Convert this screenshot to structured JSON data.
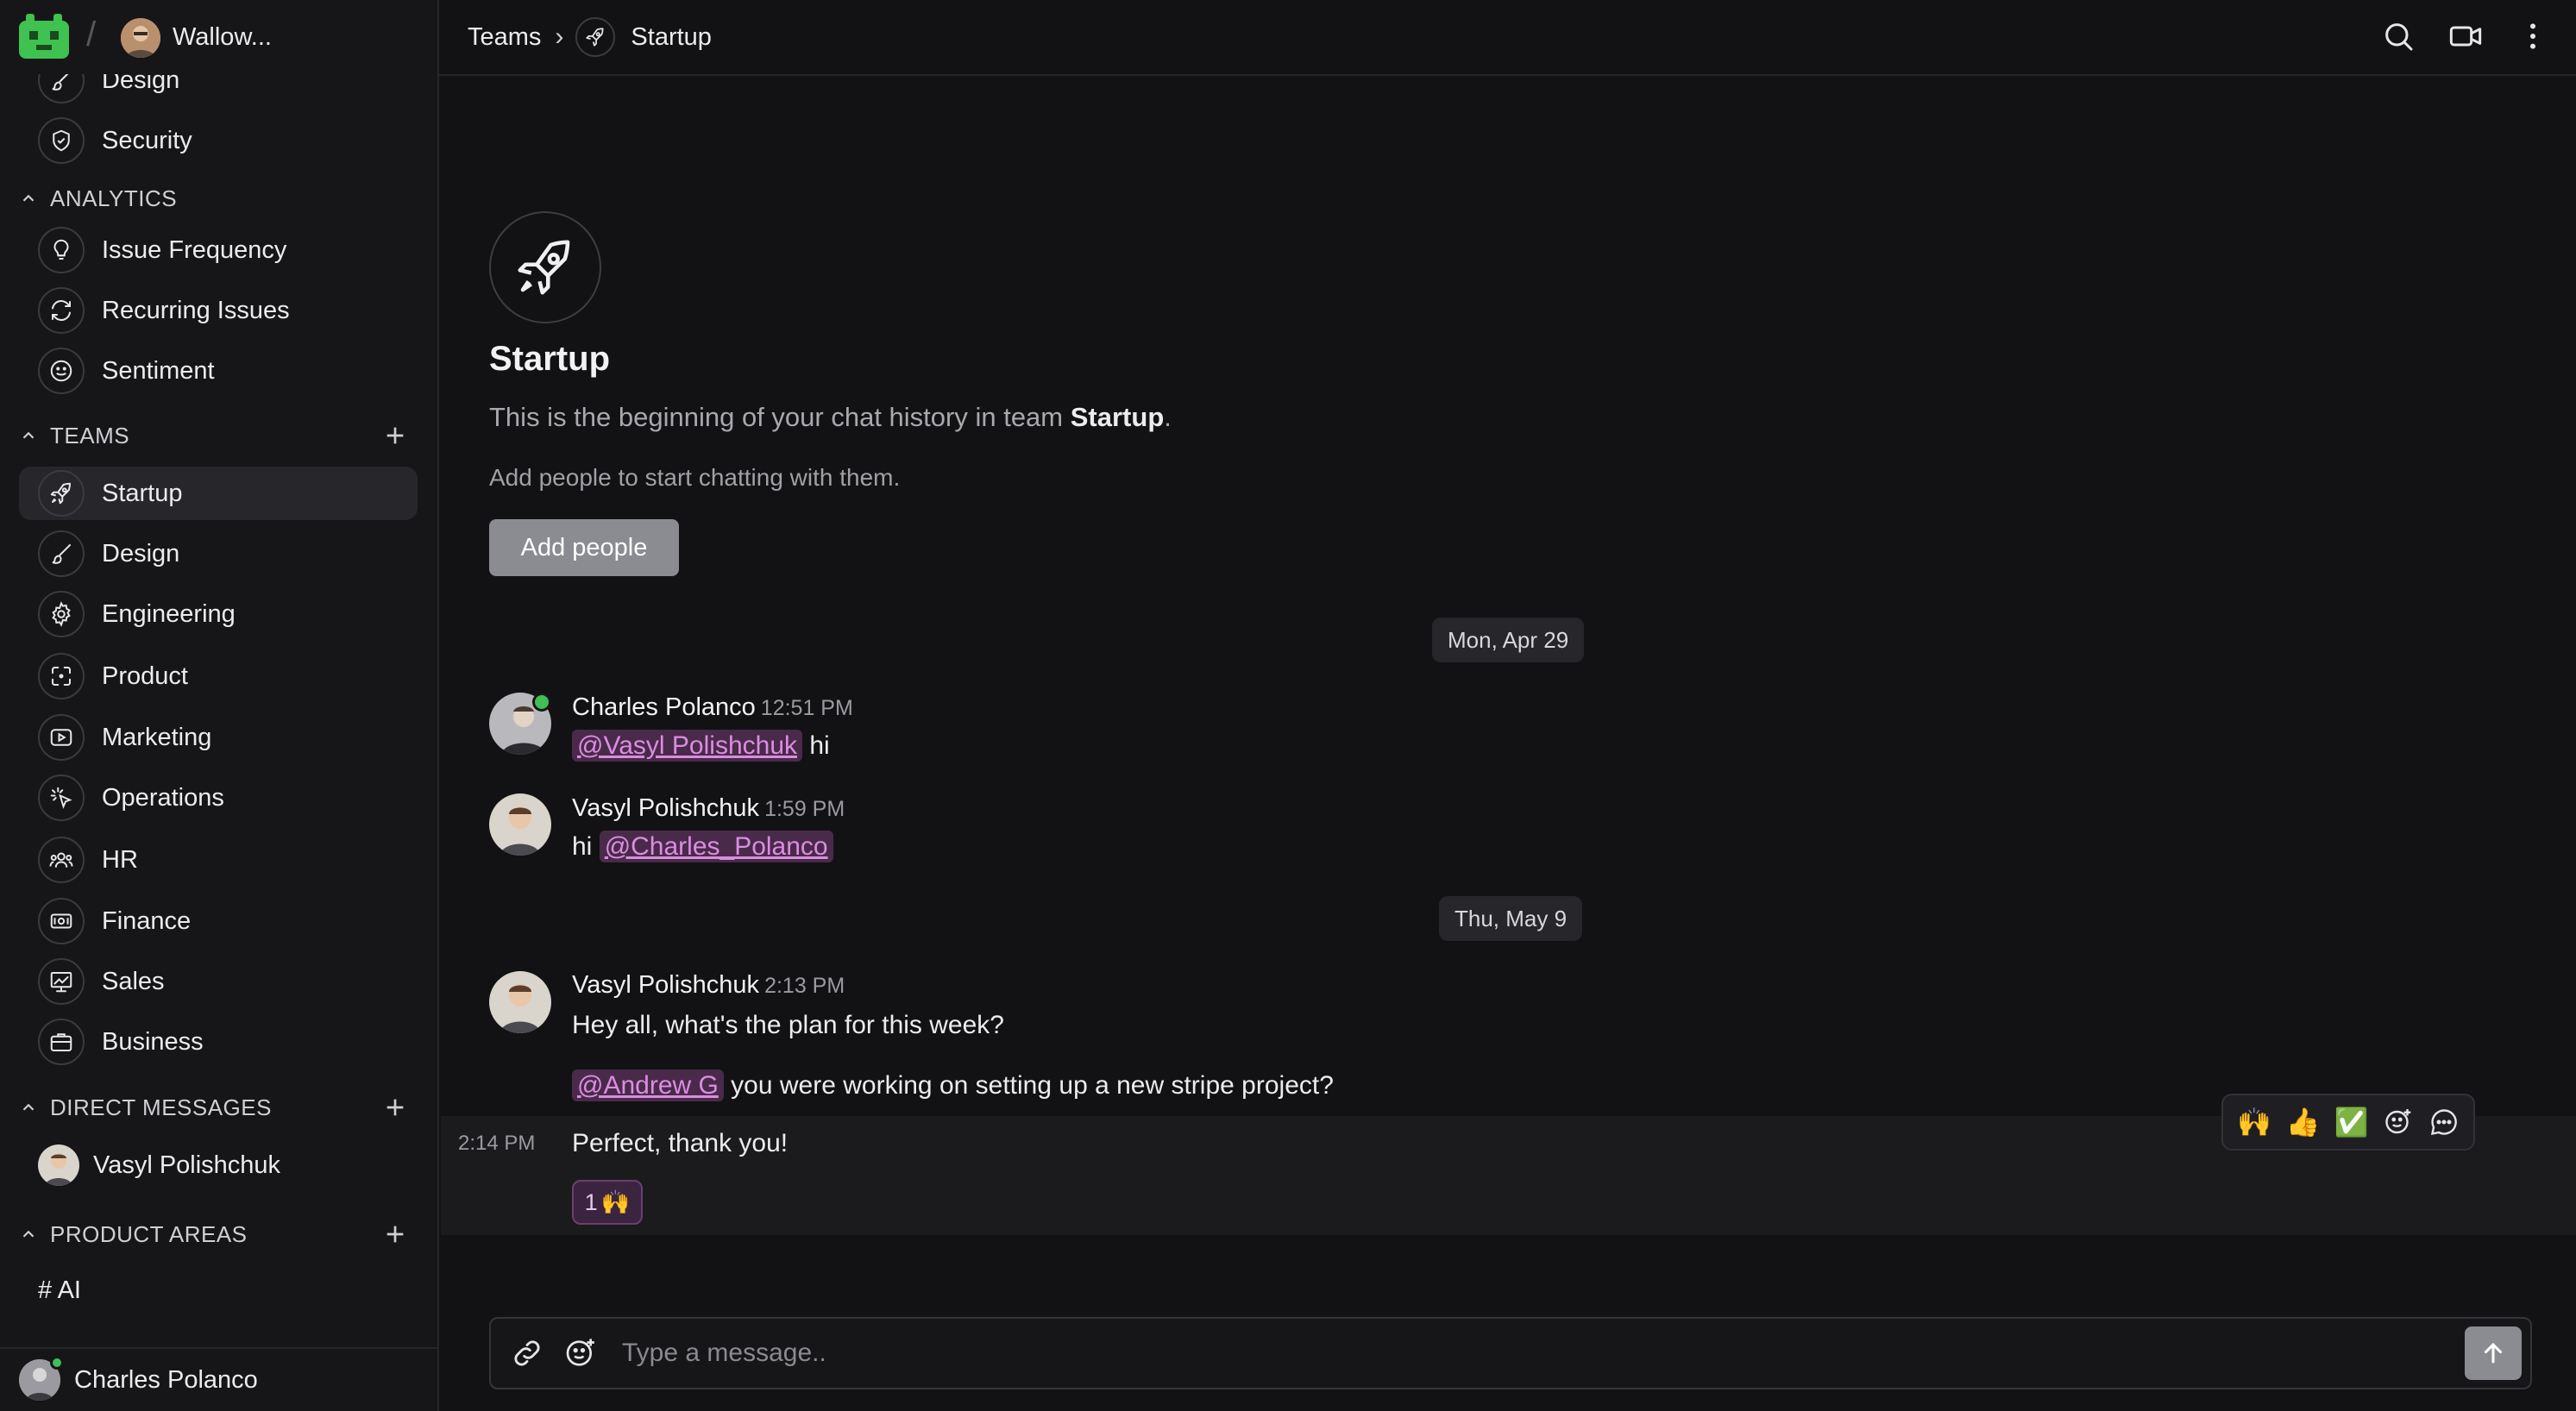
{
  "workspace": {
    "name": "Wallow..."
  },
  "sidebar": {
    "top_items": [
      {
        "label": "Design",
        "icon": "brush-icon"
      },
      {
        "label": "Security",
        "icon": "shield-icon"
      }
    ],
    "sections": {
      "analytics": {
        "title": "ANALYTICS",
        "items": [
          {
            "label": "Issue Frequency",
            "icon": "bulb-icon"
          },
          {
            "label": "Recurring Issues",
            "icon": "refresh-icon"
          },
          {
            "label": "Sentiment",
            "icon": "smiley-icon"
          }
        ]
      },
      "teams": {
        "title": "TEAMS",
        "items": [
          {
            "label": "Startup",
            "icon": "rocket-icon",
            "active": true
          },
          {
            "label": "Design",
            "icon": "brush-icon"
          },
          {
            "label": "Engineering",
            "icon": "gear-icon"
          },
          {
            "label": "Product",
            "icon": "focus-icon"
          },
          {
            "label": "Marketing",
            "icon": "play-icon"
          },
          {
            "label": "Operations",
            "icon": "cursor-icon"
          },
          {
            "label": "HR",
            "icon": "people-icon"
          },
          {
            "label": "Finance",
            "icon": "money-icon"
          },
          {
            "label": "Sales",
            "icon": "chart-icon"
          },
          {
            "label": "Business",
            "icon": "briefcase-icon"
          }
        ]
      },
      "direct_messages": {
        "title": "DIRECT MESSAGES",
        "items": [
          {
            "label": "Vasyl Polishchuk"
          }
        ]
      },
      "product_areas": {
        "title": "PRODUCT AREAS",
        "items": [
          {
            "label": "# AI"
          }
        ]
      }
    },
    "current_user": "Charles Polanco"
  },
  "header": {
    "breadcrumb_root": "Teams",
    "breadcrumb_sep": "›",
    "team": "Startup"
  },
  "intro": {
    "title": "Startup",
    "text_prefix": "This is the beginning of your chat history in team ",
    "text_team": "Startup",
    "text_suffix": ".",
    "sub": "Add people to start chatting with them.",
    "button": "Add people"
  },
  "messages": {
    "date1": "Mon, Apr 29",
    "date2": "Thu, May 9",
    "m1": {
      "author": "Charles Polanco",
      "time": "12:51 PM",
      "mention": "@Vasyl Polishchuk",
      "text": " hi"
    },
    "m2": {
      "author": "Vasyl Polishchuk",
      "time": "1:59 PM",
      "prefix": "hi ",
      "mention": "@Charles_Polanco"
    },
    "m3": {
      "author": "Vasyl Polishchuk",
      "time": "2:13 PM",
      "text": "Hey all, what's the plan for this week?"
    },
    "m4": {
      "mention": "@Andrew G",
      "text": " you were working on setting up a new stripe project?"
    },
    "m5": {
      "time": "2:14 PM",
      "text": "Perfect, thank you!",
      "reaction_count": "1",
      "reaction_emoji": "🙌"
    }
  },
  "toolbar": {
    "emoji1": "🙌",
    "emoji2": "👍",
    "emoji3": "✅"
  },
  "composer": {
    "placeholder": "Type a message.."
  },
  "colors": {
    "accent_mention": "#d98ee0",
    "online": "#3fbf55",
    "button": "#8b8b92"
  }
}
